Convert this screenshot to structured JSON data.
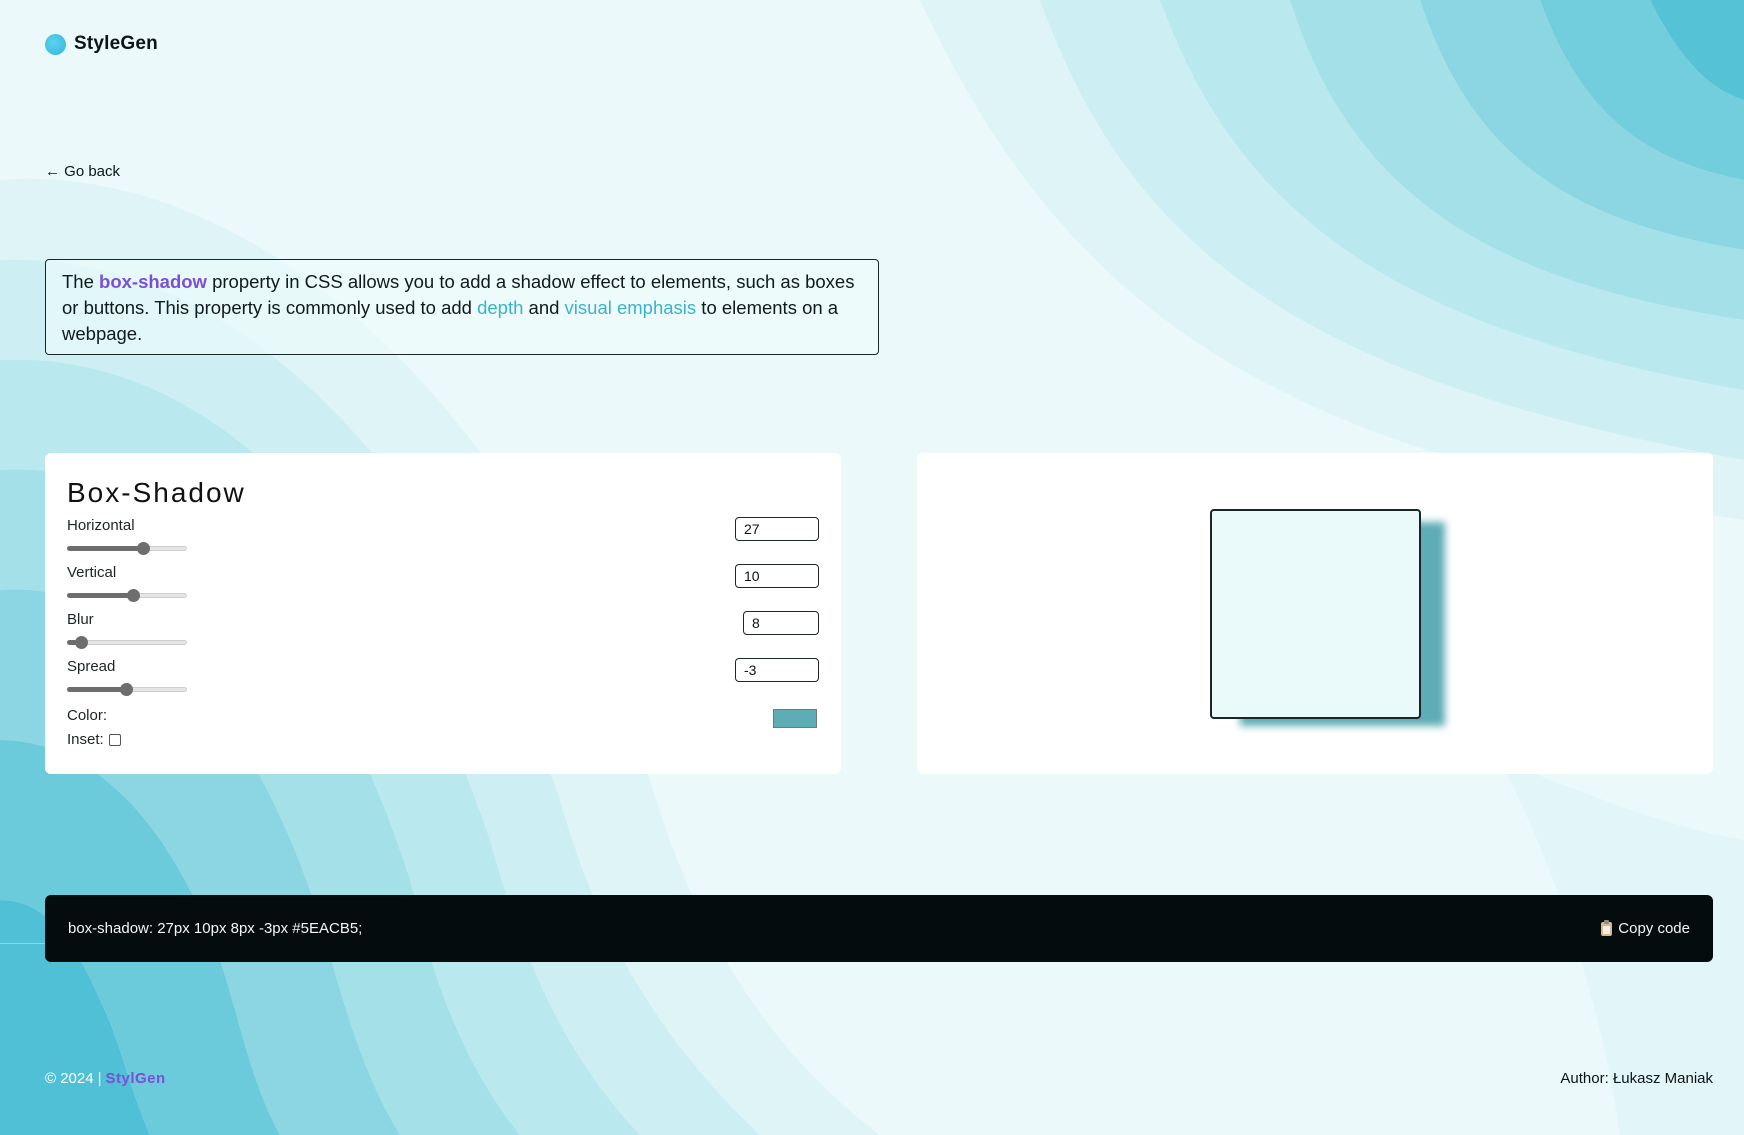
{
  "header": {
    "brand_name": "StyleGen",
    "logo_icon": "circle-logo-icon"
  },
  "nav": {
    "back_label": "← Go back"
  },
  "intro": {
    "part1": "The ",
    "highlight": "box-shadow",
    "part2": " property in CSS allows you to add a shadow effect to elements, such as boxes or buttons. This property is commonly used to add ",
    "accent1": "depth",
    "part3": " and ",
    "accent2": "visual emphasis",
    "part4": " to elements on a webpage."
  },
  "controls": {
    "title": "Box-Shadow",
    "sliders": [
      {
        "label": "Horizontal",
        "value": "27",
        "fraction": 0.63
      },
      {
        "label": "Vertical",
        "value": "10",
        "fraction": 0.55
      },
      {
        "label": "Blur",
        "value": "8",
        "fraction": 0.12
      },
      {
        "label": "Spread",
        "value": "-3",
        "fraction": 0.49
      }
    ],
    "color_label": "Color:",
    "color_value": "#5EACB5",
    "inset_label": "Inset:",
    "inset_checked": false
  },
  "code": {
    "text": "box-shadow: 27px 10px 8px -3px #5EACB5;",
    "copy_label": "Copy code",
    "copy_icon": "clipboard-icon"
  },
  "footer": {
    "copyright": "© 2024",
    "separator": "|",
    "brand": "StylGen",
    "author": "Author: Łukasz Maniak"
  },
  "colors": {
    "accent_purple": "#7b4fd8",
    "accent_cyan": "#3ab3cc",
    "shadow": "#5EACB5",
    "code_bg": "#050c0d"
  }
}
